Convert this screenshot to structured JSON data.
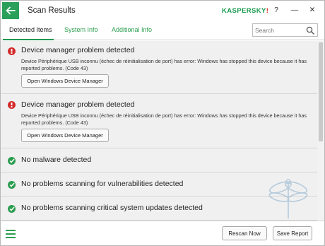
{
  "window": {
    "title": "Scan Results",
    "brand": {
      "main": "KASPERSKY",
      "accent": "!"
    },
    "help_glyph": "?",
    "minimize_glyph": "—",
    "close_glyph": "✕"
  },
  "tabs": [
    {
      "label": "Detected Items",
      "active": true
    },
    {
      "label": "System Info",
      "active": false
    },
    {
      "label": "Additional Info",
      "active": false
    }
  ],
  "search": {
    "placeholder": "Search",
    "value": ""
  },
  "results": [
    {
      "status": "error",
      "icon": "error-icon",
      "title": "Device manager problem detected",
      "description": "Device Périphérique USB inconnu (échec de réinitialisation de port) has error: Windows has stopped this device because it has reported problems. (Code 43)",
      "button": "Open Windows Device Manager"
    },
    {
      "status": "error",
      "icon": "error-icon",
      "title": "Device manager problem detected",
      "description": "Device Périphérique USB inconnu (échec de réinitialisation de port) has error: Windows has stopped this device because it has reported problems. (Code 43)",
      "button": "Open Windows Device Manager"
    },
    {
      "status": "ok",
      "icon": "check-icon",
      "title": "No malware detected"
    },
    {
      "status": "ok",
      "icon": "check-icon",
      "title": "No problems scanning for vulnerabilities detected"
    },
    {
      "status": "ok",
      "icon": "check-icon",
      "title": "No problems scanning critical system updates detected"
    }
  ],
  "footer": {
    "rescan_label": "Rescan Now",
    "save_label": "Save Report"
  },
  "colors": {
    "accent_green": "#2b9d4f",
    "error_red": "#d32a2a",
    "brand_red": "#e0312d"
  }
}
